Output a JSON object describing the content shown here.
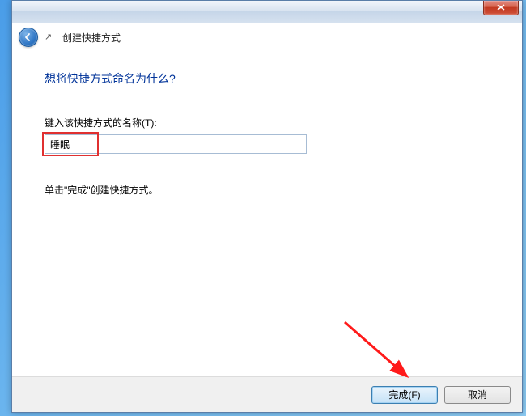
{
  "titlebar": {
    "close_tooltip": "关闭"
  },
  "header": {
    "title": "创建快捷方式"
  },
  "content": {
    "heading": "想将快捷方式命名为什么?",
    "input_label": "键入该快捷方式的名称(T):",
    "input_value": "睡眠",
    "hint": "单击\"完成\"创建快捷方式。"
  },
  "footer": {
    "finish_label": "完成(F)",
    "cancel_label": "取消"
  }
}
